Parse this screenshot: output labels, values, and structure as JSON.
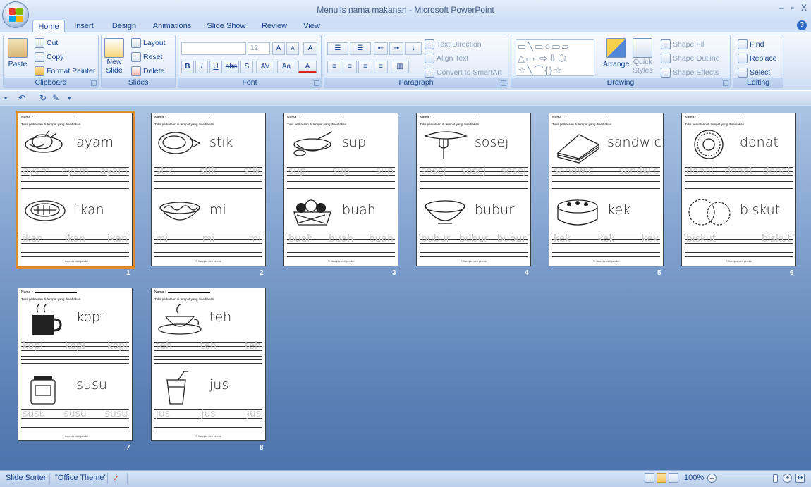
{
  "window": {
    "title": "Menulis nama makanan - Microsoft PowerPoint",
    "minimize": "–",
    "restore": "▫",
    "close": "X"
  },
  "tabs": [
    "Home",
    "Insert",
    "Design",
    "Animations",
    "Slide Show",
    "Review",
    "View"
  ],
  "active_tab": "Home",
  "ribbon": {
    "clipboard": {
      "paste": "Paste",
      "cut": "Cut",
      "copy": "Copy",
      "format_painter": "Format Painter",
      "label": "Clipboard"
    },
    "slides": {
      "new_slide": "New",
      "new_slide2": "Slide",
      "layout": "Layout",
      "reset": "Reset",
      "delete": "Delete",
      "label": "Slides"
    },
    "font": {
      "name": "",
      "size": "12",
      "bold": "B",
      "italic": "I",
      "underline": "U",
      "strike": "abe",
      "shadow": "S",
      "spacing": "AV",
      "case": "Aa",
      "color": "A",
      "grow": "A",
      "shrink": "A",
      "clear": "A",
      "label": "Font"
    },
    "paragraph": {
      "text_direction": "Text Direction",
      "align_text": "Align Text",
      "convert_smartart": "Convert to SmartArt",
      "label": "Paragraph"
    },
    "drawing": {
      "arrange": "Arrange",
      "quick": "Quick",
      "styles": "Styles",
      "shape_fill": "Shape Fill",
      "shape_outline": "Shape Outline",
      "shape_effects": "Shape Effects",
      "label": "Drawing"
    },
    "editing": {
      "find": "Find",
      "replace": "Replace",
      "select": "Select",
      "label": "Editing"
    }
  },
  "slides": [
    {
      "num": "1",
      "words": [
        "ayam",
        "ikan"
      ],
      "selected": true
    },
    {
      "num": "2",
      "words": [
        "stik",
        "mi"
      ],
      "selected": false
    },
    {
      "num": "3",
      "words": [
        "sup",
        "buah"
      ],
      "selected": false
    },
    {
      "num": "4",
      "words": [
        "sosej",
        "bubur"
      ],
      "selected": false
    },
    {
      "num": "5",
      "words": [
        "sandwic",
        "kek"
      ],
      "selected": false
    },
    {
      "num": "6",
      "words": [
        "donat",
        "biskut"
      ],
      "selected": false
    },
    {
      "num": "7",
      "words": [
        "kopi",
        "susu"
      ],
      "selected": false
    },
    {
      "num": "8",
      "words": [
        "teh",
        "jus"
      ],
      "selected": false
    }
  ],
  "slide_text": {
    "nama": "Nama :",
    "instruction": "Tulis perkataan di tempat yang disediakan.",
    "footer": "© Hakcipta oleh pemilik"
  },
  "status": {
    "view": "Slide Sorter",
    "theme": "\"Office Theme\"",
    "zoom": "100%"
  }
}
